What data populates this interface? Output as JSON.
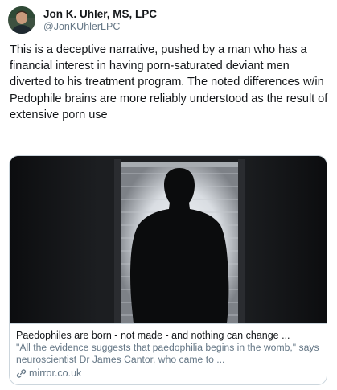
{
  "user": {
    "display_name": "Jon K. Uhler, MS, LPC",
    "handle": "@JonKUhlerLPC",
    "avatar_icon": "profile-photo"
  },
  "tweet": {
    "text": "This is a deceptive narrative, pushed by a man who has a financial interest in having porn-saturated deviant men diverted to his treatment program. The noted differences w/in Pedophile brains are more reliably understood as the result of extensive porn use"
  },
  "link_card": {
    "image_icon": "silhouette-man-window-photo",
    "title": "Paedophiles are born - not made - and nothing can change ...",
    "description": "\"All the evidence suggests that paedophilia begins in the womb,\" says neuroscientist Dr James Cantor, who came to ...",
    "domain_icon": "link-icon",
    "domain": "mirror.co.uk"
  },
  "colors": {
    "text_primary": "#14171a",
    "text_secondary": "#657786",
    "border": "#ccd6dd"
  }
}
